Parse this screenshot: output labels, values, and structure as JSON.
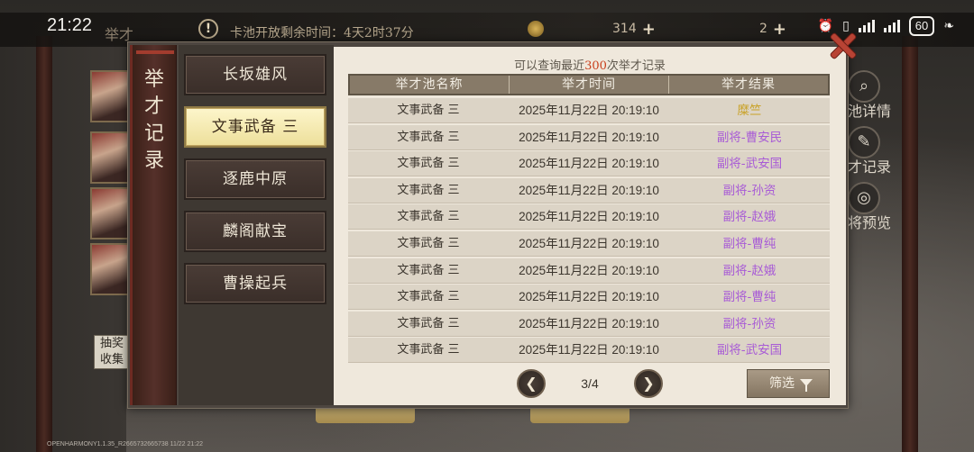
{
  "status_bar": {
    "time": "21:22",
    "battery": "60"
  },
  "top_bar": {
    "title": "举才",
    "notice": "卡池开放剩余时间：4天2时37分",
    "resource1_value": "314",
    "resource2_value": "2"
  },
  "side": {
    "collect_button": "抽奖收集"
  },
  "right_menu": {
    "item1": "池详情",
    "item2": "才记录",
    "item3": "将预览"
  },
  "modal": {
    "title": "举才记录",
    "tabs": [
      {
        "label": "长坂雄风",
        "active": false
      },
      {
        "label": "文事武备 三",
        "active": true
      },
      {
        "label": "逐鹿中原",
        "active": false
      },
      {
        "label": "麟阁献宝",
        "active": false
      },
      {
        "label": "曹操起兵",
        "active": false
      }
    ],
    "query_note_prefix": "可以查询最近",
    "query_note_count": "300",
    "query_note_suffix": "次举才记录",
    "columns": [
      "举才池名称",
      "举才时间",
      "举才结果"
    ],
    "rows": [
      {
        "pool": "文事武备 三",
        "time": "2025年11月22日 20:19:10",
        "result": "糜竺",
        "result_color": "#c9a227"
      },
      {
        "pool": "文事武备 三",
        "time": "2025年11月22日 20:19:10",
        "result": "副将-曹安民",
        "result_color": "#a85bd6"
      },
      {
        "pool": "文事武备 三",
        "time": "2025年11月22日 20:19:10",
        "result": "副将-武安国",
        "result_color": "#a85bd6"
      },
      {
        "pool": "文事武备 三",
        "time": "2025年11月22日 20:19:10",
        "result": "副将-孙资",
        "result_color": "#a85bd6"
      },
      {
        "pool": "文事武备 三",
        "time": "2025年11月22日 20:19:10",
        "result": "副将-赵娥",
        "result_color": "#a85bd6"
      },
      {
        "pool": "文事武备 三",
        "time": "2025年11月22日 20:19:10",
        "result": "副将-曹纯",
        "result_color": "#a85bd6"
      },
      {
        "pool": "文事武备 三",
        "time": "2025年11月22日 20:19:10",
        "result": "副将-赵娥",
        "result_color": "#a85bd6"
      },
      {
        "pool": "文事武备 三",
        "time": "2025年11月22日 20:19:10",
        "result": "副将-曹纯",
        "result_color": "#a85bd6"
      },
      {
        "pool": "文事武备 三",
        "time": "2025年11月22日 20:19:10",
        "result": "副将-孙资",
        "result_color": "#a85bd6"
      },
      {
        "pool": "文事武备 三",
        "time": "2025年11月22日 20:19:10",
        "result": "副将-武安国",
        "result_color": "#a85bd6"
      }
    ],
    "page": "3/4",
    "filter_label": "筛选"
  },
  "watermark": "OPENHARMONY1.1.35_R2665732665738 11/22 21:22"
}
